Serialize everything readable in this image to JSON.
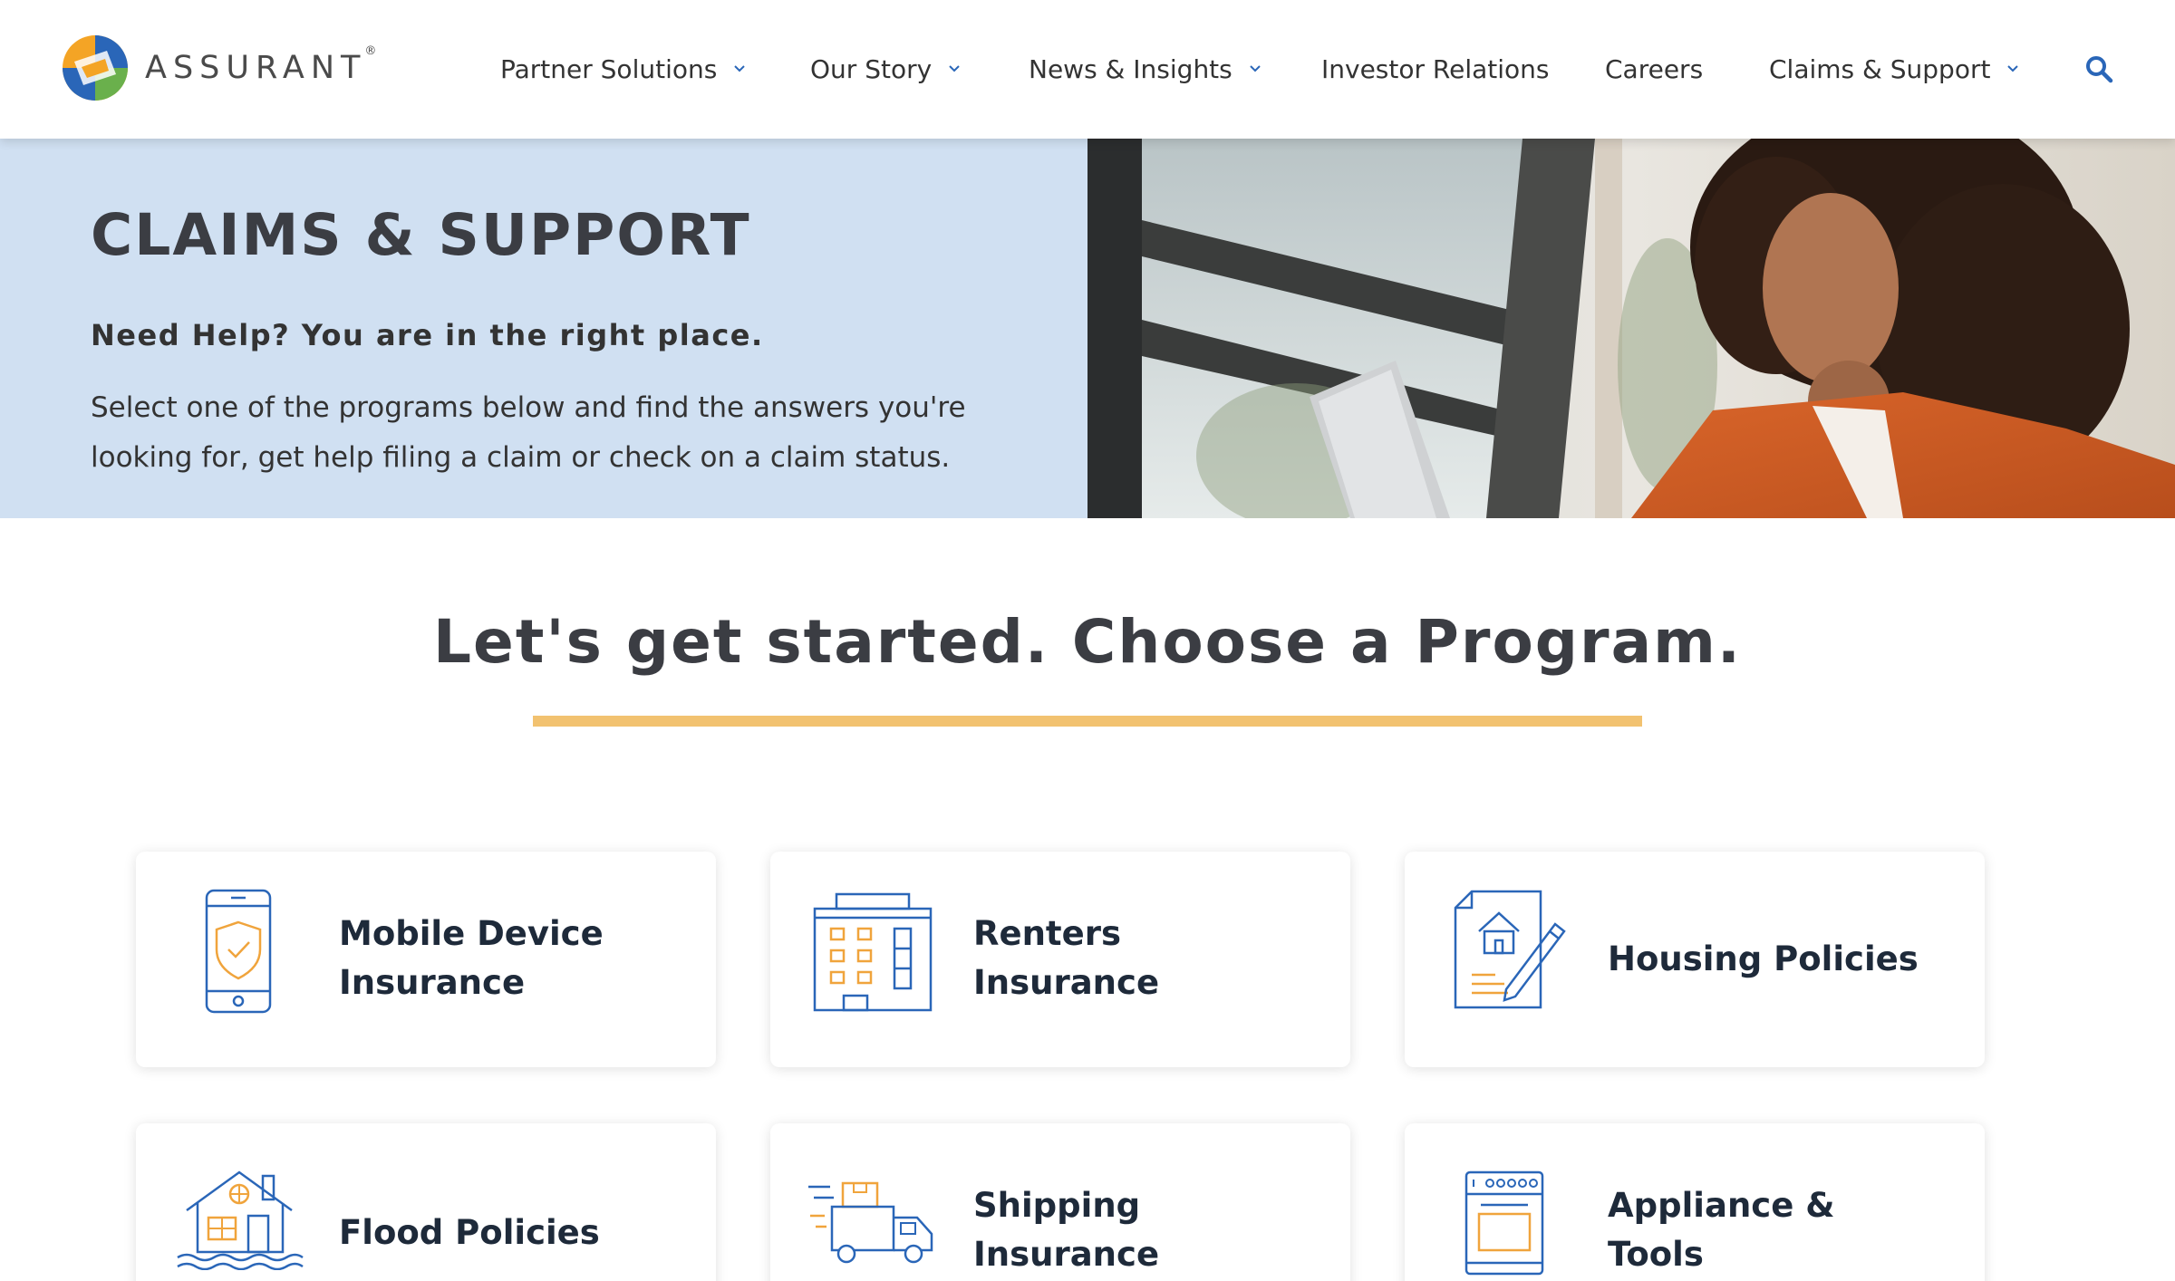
{
  "brand": {
    "name": "ASSURANT",
    "reg": "®"
  },
  "nav": {
    "items": [
      {
        "label": "Partner Solutions",
        "dropdown": true
      },
      {
        "label": "Our Story",
        "dropdown": true
      },
      {
        "label": "News & Insights",
        "dropdown": true
      },
      {
        "label": "Investor Relations",
        "dropdown": false
      },
      {
        "label": "Careers",
        "dropdown": false
      },
      {
        "label": "Claims & Support",
        "dropdown": true
      }
    ],
    "search_icon": "search-icon"
  },
  "hero": {
    "title": "CLAIMS & SUPPORT",
    "subtitle": "Need Help? You are in the right place.",
    "body": "Select one of the programs below and find the answers you're looking for, get help filing a claim or check on a claim status."
  },
  "section": {
    "title": "Let's get started. Choose a Program."
  },
  "programs": [
    {
      "label": "Mobile Device Insurance",
      "icon": "phone-shield-icon"
    },
    {
      "label": "Renters Insurance",
      "icon": "apartment-building-icon"
    },
    {
      "label": "Housing Policies",
      "icon": "house-document-icon"
    },
    {
      "label": "Flood Policies",
      "icon": "flood-house-icon"
    },
    {
      "label": "Shipping Insurance",
      "icon": "delivery-truck-icon"
    },
    {
      "label": "Appliance & Tools",
      "icon": "oven-icon"
    }
  ],
  "colors": {
    "accent_blue": "#2a66b8",
    "accent_orange": "#f0a43c",
    "hero_bg": "#d0e0f2",
    "underline": "#f2c270",
    "text_dark": "#3b3d43"
  }
}
